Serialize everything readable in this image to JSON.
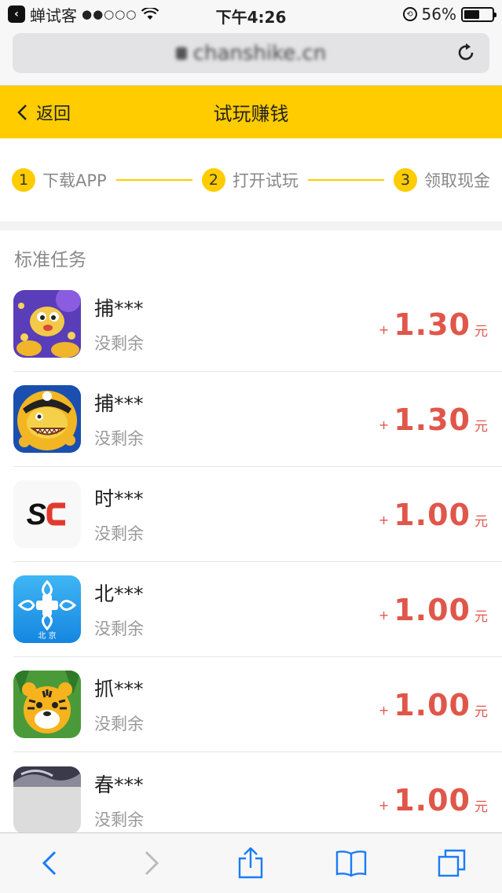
{
  "status_bar": {
    "back_app": "蝉试客",
    "signal": "●●○○○",
    "time": "下午4:26",
    "battery": "56%",
    "battery_level": 0.56
  },
  "browser": {
    "url": "chanshike.cn"
  },
  "header": {
    "back_label": "返回",
    "title": "试玩赚钱"
  },
  "steps": [
    {
      "num": "1",
      "label": "下载APP"
    },
    {
      "num": "2",
      "label": "打开试玩"
    },
    {
      "num": "3",
      "label": "领取现金"
    }
  ],
  "section_title": "标准任务",
  "tasks": [
    {
      "name": "捕***",
      "status": "没剩余",
      "plus": "+",
      "amount": "1.30",
      "unit": "元",
      "icon": "fish-game-icon"
    },
    {
      "name": "捕***",
      "status": "没剩余",
      "plus": "+",
      "amount": "1.30",
      "unit": "元",
      "icon": "shark-game-icon"
    },
    {
      "name": "时***",
      "status": "没剩余",
      "plus": "+",
      "amount": "1.00",
      "unit": "元",
      "icon": "sc-logo-icon",
      "logo_text": "SC"
    },
    {
      "name": "北***",
      "status": "没剩余",
      "plus": "+",
      "amount": "1.00",
      "unit": "元",
      "icon": "beijing-health-icon",
      "logo_text": "北 京"
    },
    {
      "name": "抓***",
      "status": "没剩余",
      "plus": "+",
      "amount": "1.00",
      "unit": "元",
      "icon": "tiger-game-icon"
    },
    {
      "name": "春***",
      "status": "没剩余",
      "plus": "+",
      "amount": "1.00",
      "unit": "元",
      "icon": "spring-app-icon"
    }
  ],
  "colors": {
    "accent_yellow": "#ffcc00",
    "price_red": "#e0574a",
    "ios_blue": "#1a7cf5"
  }
}
